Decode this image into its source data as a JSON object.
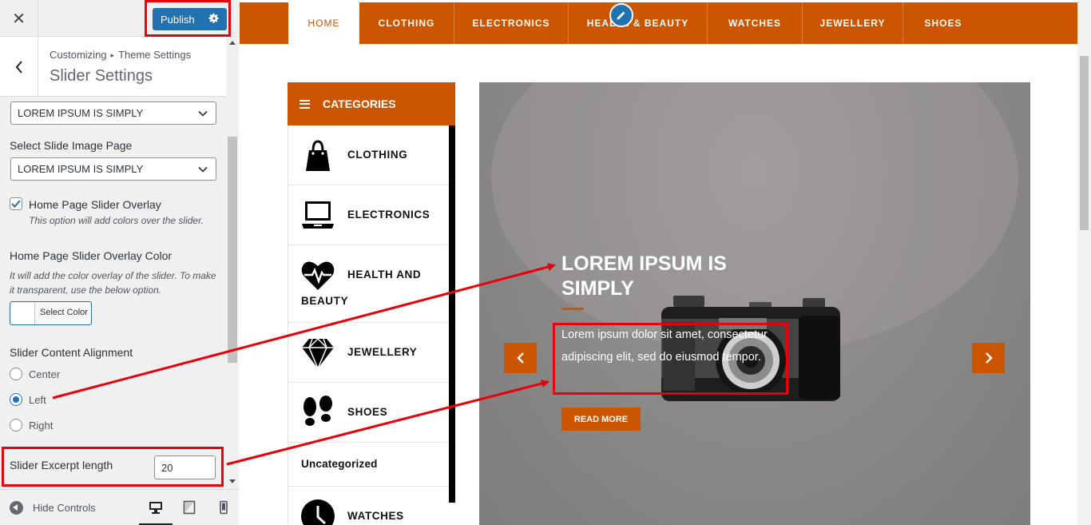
{
  "customizer": {
    "close_label": "✕",
    "publish_label": "Publish",
    "breadcrumb": {
      "root": "Customizing",
      "separator": "▸",
      "parent": "Theme Settings"
    },
    "section_title": "Slider Settings",
    "slide_page_select_value": "LOREM IPSUM IS SIMPLY",
    "slide_image_page": {
      "label": "Select Slide Image Page",
      "value": "LOREM IPSUM IS SIMPLY"
    },
    "overlay_checkbox": {
      "label": "Home Page Slider Overlay",
      "description": "This option will add colors over the slider.",
      "checked": true
    },
    "overlay_color": {
      "label": "Home Page Slider Overlay Color",
      "description": "It will add the color overlay of the slider. To make it transparent, use the below option.",
      "button_label": "Select Color"
    },
    "alignment": {
      "label": "Slider Content Alignment",
      "options": [
        "Center",
        "Left",
        "Right"
      ],
      "selected": "Left"
    },
    "excerpt_length": {
      "label": "Slider Excerpt length",
      "value": "20"
    },
    "footer": {
      "hide_controls_label": "Hide Controls",
      "active_device": "desktop"
    }
  },
  "preview": {
    "nav": [
      "HOME",
      "CLOTHING",
      "ELECTRONICS",
      "HEALTH & BEAUTY",
      "WATCHES",
      "JEWELLERY",
      "SHOES"
    ],
    "categories_title": "CATEGORIES",
    "categories": [
      {
        "icon": "shopping-bag-icon",
        "label": "CLOTHING"
      },
      {
        "icon": "laptop-icon",
        "label": "ELECTRONICS"
      },
      {
        "icon": "heart-pulse-icon",
        "label_line1": "HEALTH AND",
        "label_line2": "BEAUTY"
      },
      {
        "icon": "diamond-icon",
        "label": "JEWELLERY"
      },
      {
        "icon": "footprints-icon",
        "label": "SHOES"
      },
      {
        "label": "Uncategorized"
      },
      {
        "icon": "clock-icon",
        "label": "WATCHES"
      }
    ],
    "slide": {
      "title": "LOREM IPSUM IS SIMPLY",
      "excerpt": "Lorem ipsum dolor sit amet, consectetur adipiscing elit, sed do eiusmod tempor.",
      "button": "READ MORE"
    }
  },
  "colors": {
    "accent": "#cc5500",
    "wp_blue": "#2271b1",
    "annotation_red": "#e8000b"
  }
}
